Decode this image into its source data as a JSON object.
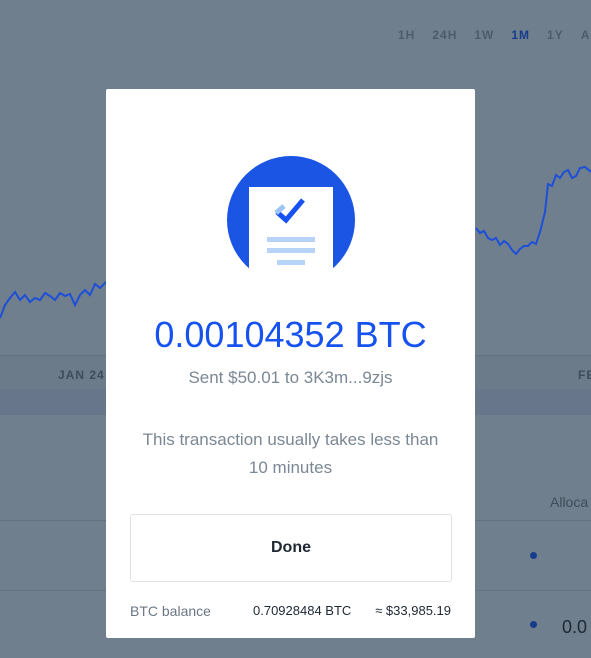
{
  "background": {
    "range_tabs": [
      {
        "label": "1H",
        "active": false
      },
      {
        "label": "24H",
        "active": false
      },
      {
        "label": "1W",
        "active": false
      },
      {
        "label": "1M",
        "active": true
      },
      {
        "label": "1Y",
        "active": false
      },
      {
        "label": "AL",
        "active": false
      }
    ],
    "date_labels": [
      "JAN 24",
      "FE"
    ],
    "allocation_header": "Alloca",
    "row_value": "0.0"
  },
  "modal": {
    "icon": "transaction-document-check-icon",
    "amount": "0.00104352 BTC",
    "sent_line": "Sent $50.01 to 3K3m...9zjs",
    "notice": "This transaction usually takes less than 10 minutes",
    "done_label": "Done",
    "balance_label": "BTC balance",
    "balance_btc": "0.70928484 BTC",
    "balance_usd": "≈ $33,985.19"
  },
  "colors": {
    "accent": "#1652f0",
    "overlay": "#6f7f8e",
    "chart_line": "#1d4fd8"
  }
}
